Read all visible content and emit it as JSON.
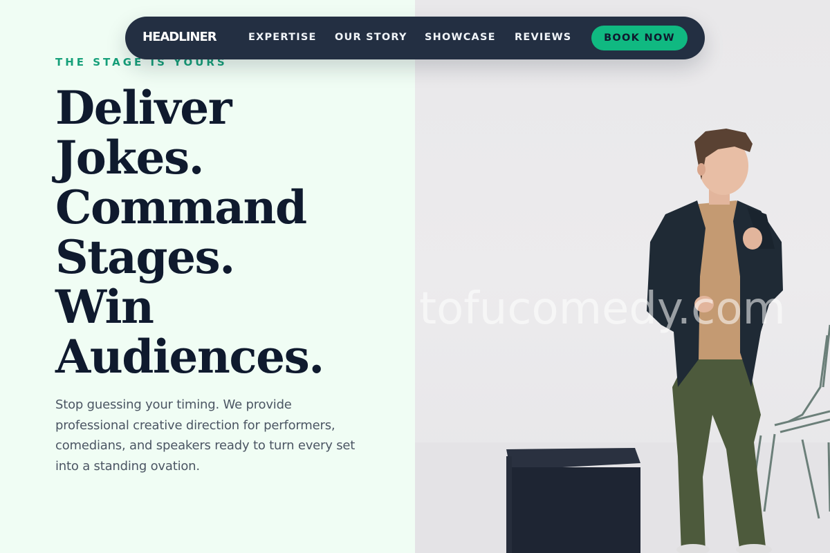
{
  "nav": {
    "logo": "HEADLINER",
    "links": [
      "EXPERTISE",
      "OUR STORY",
      "SHOWCASE",
      "REVIEWS"
    ],
    "cta": "BOOK NOW"
  },
  "hero": {
    "eyebrow": "THE STAGE IS YOURS",
    "headline_lines": [
      "Deliver",
      "Jokes.",
      "Command",
      "Stages.",
      "Win",
      "Audiences."
    ],
    "description": "Stop guessing your timing. We provide professional creative direction for performers, comedians, and speakers ready to turn every set into a standing ovation.",
    "watermark": "tofucomedy.com"
  },
  "colors": {
    "accent": "#10b981",
    "eyebrow": "#16a07a",
    "heading": "#0f1a2e",
    "nav_bg": "#232f42",
    "left_bg": "#f0fdf4"
  }
}
